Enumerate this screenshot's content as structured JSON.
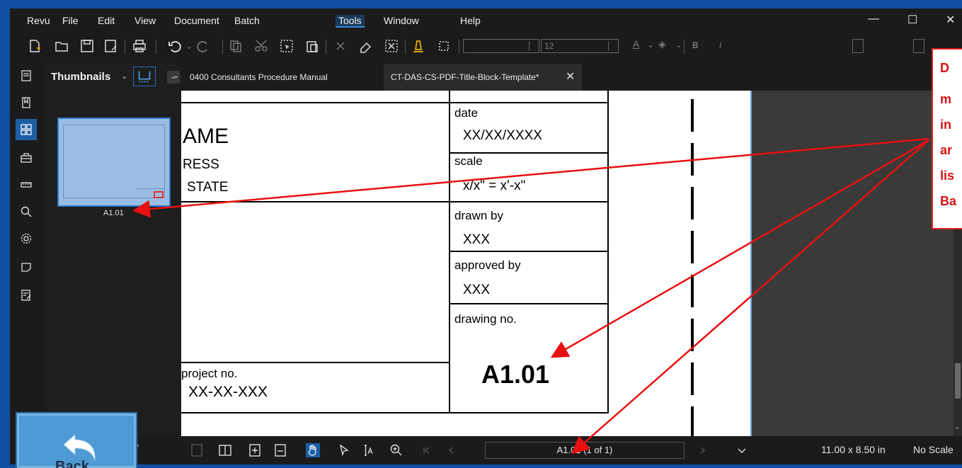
{
  "menu": {
    "items": [
      "Revu",
      "File",
      "Edit",
      "View",
      "Document",
      "Batch",
      "Tools",
      "Window",
      "Help"
    ],
    "active": "Tools",
    "window_controls": {
      "minimize": "—",
      "maximize": "☐",
      "close": "✕"
    }
  },
  "toolbar": {
    "font_size_value": "12",
    "icons": [
      "new-document-icon",
      "open-folder-icon",
      "save-icon",
      "save-as-icon",
      "print-icon",
      "undo-icon",
      "redo-icon",
      "copy-icon",
      "cut-icon",
      "select-icon",
      "paste-icon",
      "delete-icon",
      "eraser-icon",
      "snapshot-icon",
      "highlight-icon",
      "crop-icon"
    ],
    "bold_label": "B",
    "italic_label": "I",
    "text_color_label": "A"
  },
  "thumbnails": {
    "title": "Thumbnails",
    "label": "A1.01"
  },
  "tabs": [
    {
      "label": "0400 Consultants Procedure Manual",
      "active": false
    },
    {
      "label": "CT-DAS-CS-PDF-Title-Block-Template*",
      "active": true
    }
  ],
  "tab_close": "✕",
  "titleblock": {
    "name_fragment": "AME",
    "address_fragment": "RESS",
    "state_fragment": "STATE",
    "date_label": "date",
    "date_value": "XX/XX/XXXX",
    "scale_label": "scale",
    "scale_value": "x/x\" = x'-x\"",
    "drawn_by_label": "drawn by",
    "drawn_by_value": "XXX",
    "approved_by_label": "approved by",
    "approved_by_value": "XXX",
    "drawing_no_label": "drawing no.",
    "drawing_no_value": "A1.01",
    "project_no_label": "project no.",
    "project_no_value": "XX-XX-XXX"
  },
  "status": {
    "page_nav": "A1.01 (1 of 1)",
    "page_size": "11.00 x 8.50 in",
    "scale": "No Scale"
  },
  "callout": {
    "lines": [
      "D",
      "m",
      "in",
      "ar",
      "lis",
      "Ba"
    ],
    "border_color": "#e02020",
    "text_color": "#d81414"
  },
  "back_button": {
    "label": "Back"
  },
  "colors": {
    "frame": "#0f4fa0",
    "accent": "#1d5fa5",
    "thumbnail_border": "#2a7bd0",
    "arrow": "#e81010"
  }
}
